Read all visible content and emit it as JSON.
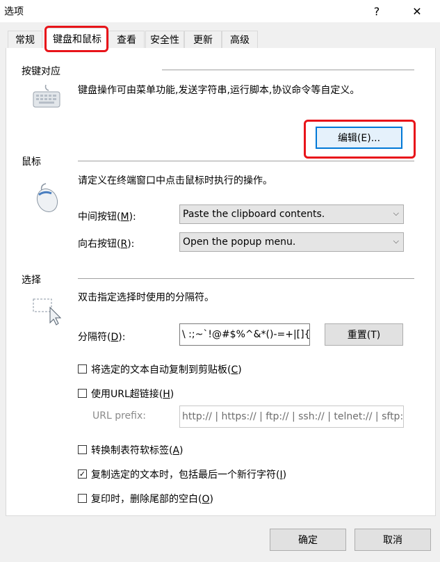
{
  "window": {
    "title": "选项",
    "help_label": "?",
    "close_label": "✕"
  },
  "tabs": [
    {
      "label": "常规"
    },
    {
      "label": "键盘和鼠标"
    },
    {
      "label": "查看"
    },
    {
      "label": "安全性"
    },
    {
      "label": "更新"
    },
    {
      "label": "高级"
    }
  ],
  "keyboard": {
    "heading": "按键对应",
    "description": "键盘操作可由菜单功能,发送字符串,运行脚本,协议命令等自定义。",
    "edit_label": "编辑(E)..."
  },
  "mouse": {
    "heading": "鼠标",
    "description": "请定义在终端窗口中点击鼠标时执行的操作。",
    "middle_label": "中间按钮(",
    "middle_key": "M",
    "middle_suffix": "):",
    "middle_value": "Paste the clipboard contents.",
    "right_label": "向右按钮(",
    "right_key": "R",
    "right_suffix": "):",
    "right_value": "Open the popup menu."
  },
  "selection": {
    "heading": "选择",
    "description": "双击指定选择时使用的分隔符。",
    "delim_label": "分隔符(",
    "delim_key": "D",
    "delim_suffix": "):",
    "delim_value": "\\ :;~`!@#$%^&*()-=+|[]{}'",
    "reset_label": "重置(T)",
    "auto_copy_label": "将选定的文本自动复制到剪贴板(",
    "auto_copy_key": "C",
    "auto_copy_suffix": ")",
    "auto_copy_checked": false,
    "url_label": "使用URL超链接(",
    "url_key": "H",
    "url_suffix": ")",
    "url_checked": false,
    "url_prefix_label": "URL prefix:",
    "url_prefix_value": "http:// | https:// | ftp:// | ssh:// | telnet:// | sftp://",
    "tab_label": "转换制表符软标签(",
    "tab_key": "A",
    "tab_suffix": ")",
    "tab_checked": false,
    "newline_label": "复制选定的文本时，包括最后一个新行字符(",
    "newline_key": "I",
    "newline_suffix": ")",
    "newline_checked": true,
    "trim_label": "复印时，删除尾部的空白(",
    "trim_key": "O",
    "trim_suffix": ")",
    "trim_checked": false
  },
  "footer": {
    "ok_label": "确定",
    "cancel_label": "取消"
  },
  "colors": {
    "highlight": "#e8141a",
    "focus": "#0078d7"
  }
}
